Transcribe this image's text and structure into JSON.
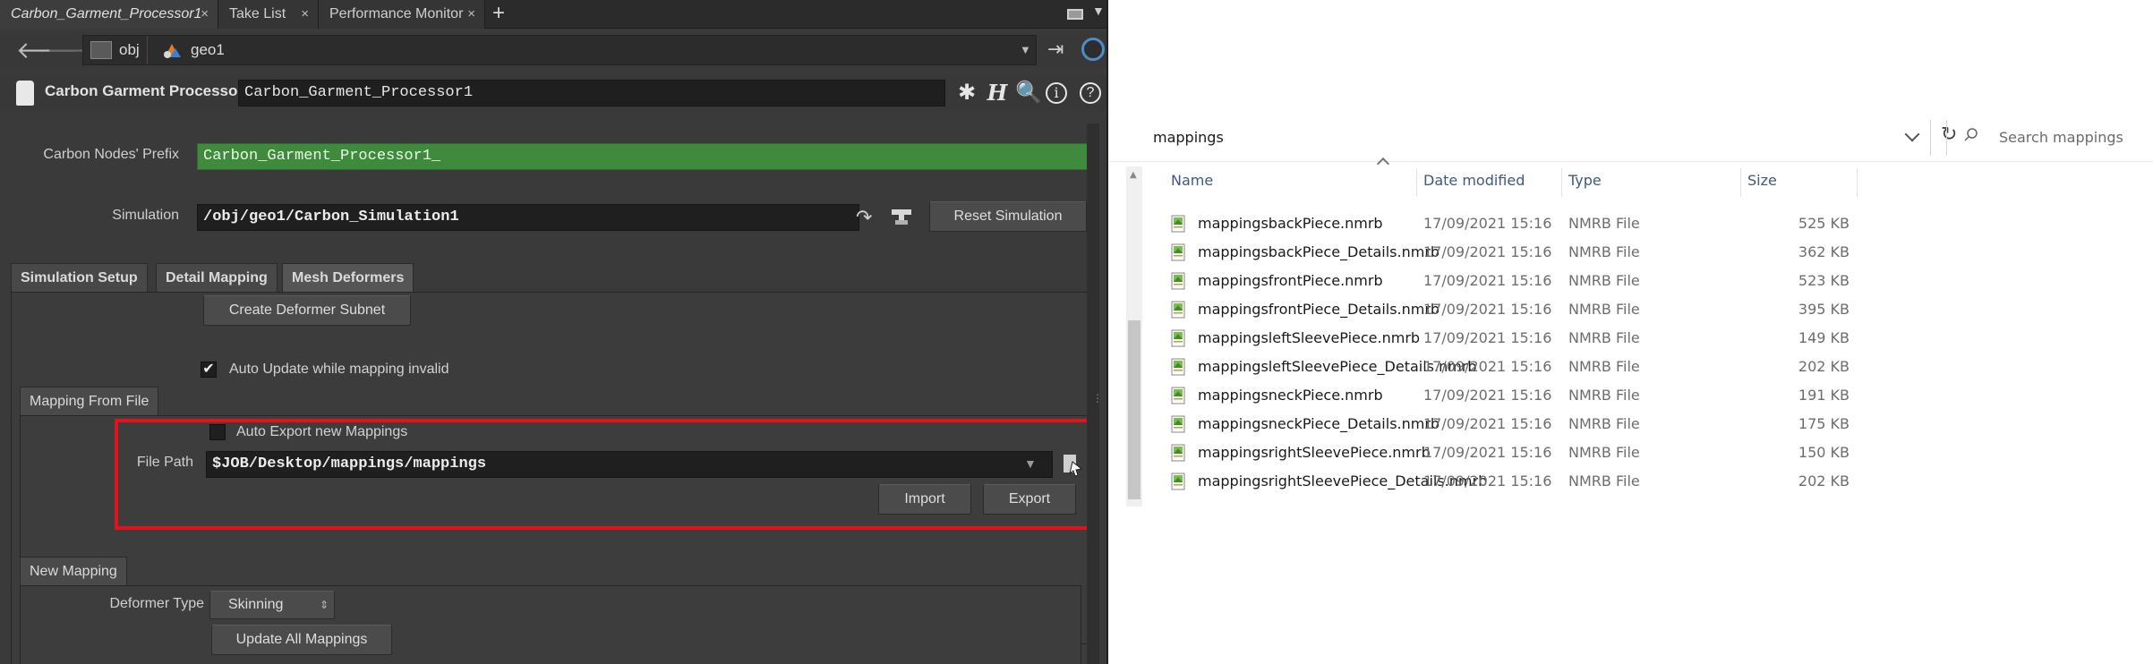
{
  "houdini": {
    "tabs": [
      {
        "label": "Carbon_Garment_Processor1",
        "close": "×"
      },
      {
        "label": "Take List",
        "close": "×"
      },
      {
        "label": "Performance Monitor",
        "close": "×"
      }
    ],
    "add_tab": "+",
    "path": {
      "crumb1": "obj",
      "crumb2": "geo1"
    },
    "node": {
      "type_label": "Carbon Garment Processor",
      "name": "Carbon_Garment_Processor1"
    },
    "prefix": {
      "label": "Carbon Nodes' Prefix",
      "value": "Carbon_Garment_Processor1_"
    },
    "simulation": {
      "label": "Simulation",
      "value": "/obj/geo1/Carbon_Simulation1",
      "reset_label": "Reset Simulation"
    },
    "main_tabs": [
      "Simulation Setup",
      "Detail Mapping",
      "Mesh Deformers"
    ],
    "create_subnet_label": "Create Deformer Subnet",
    "auto_update": {
      "label": "Auto Update while mapping invalid",
      "checked": true
    },
    "mapping_from_file": {
      "tab_label": "Mapping From File",
      "auto_export": {
        "label": "Auto Export new Mappings",
        "checked": false
      },
      "file_path_label": "File Path",
      "file_path_value": "$JOB/Desktop/mappings/mappings",
      "import_label": "Import",
      "export_label": "Export",
      "highlight_color": "#e0121c"
    },
    "new_mapping": {
      "tab_label": "New Mapping",
      "deformer_type_label": "Deformer Type",
      "deformer_type_value": "Skinning",
      "update_all_label": "Update All Mappings"
    },
    "colors": {
      "prefix_field": "#3f8a3c"
    }
  },
  "explorer": {
    "address": "mappings",
    "search_placeholder": "Search mappings",
    "columns": {
      "name": "Name",
      "date": "Date modified",
      "type": "Type",
      "size": "Size"
    },
    "files": [
      {
        "name": "mappingsbackPiece.nmrb",
        "date": "17/09/2021 15:16",
        "type": "NMRB File",
        "size": "525 KB"
      },
      {
        "name": "mappingsbackPiece_Details.nmrb",
        "date": "17/09/2021 15:16",
        "type": "NMRB File",
        "size": "362 KB"
      },
      {
        "name": "mappingsfrontPiece.nmrb",
        "date": "17/09/2021 15:16",
        "type": "NMRB File",
        "size": "523 KB"
      },
      {
        "name": "mappingsfrontPiece_Details.nmrb",
        "date": "17/09/2021 15:16",
        "type": "NMRB File",
        "size": "395 KB"
      },
      {
        "name": "mappingsleftSleevePiece.nmrb",
        "date": "17/09/2021 15:16",
        "type": "NMRB File",
        "size": "149 KB"
      },
      {
        "name": "mappingsleftSleevePiece_Details.nmrb",
        "date": "17/09/2021 15:16",
        "type": "NMRB File",
        "size": "202 KB"
      },
      {
        "name": "mappingsneckPiece.nmrb",
        "date": "17/09/2021 15:16",
        "type": "NMRB File",
        "size": "191 KB"
      },
      {
        "name": "mappingsneckPiece_Details.nmrb",
        "date": "17/09/2021 15:16",
        "type": "NMRB File",
        "size": "175 KB"
      },
      {
        "name": "mappingsrightSleevePiece.nmrb",
        "date": "17/09/2021 15:16",
        "type": "NMRB File",
        "size": "150 KB"
      },
      {
        "name": "mappingsrightSleevePiece_Details.nmrb",
        "date": "17/09/2021 15:16",
        "type": "NMRB File",
        "size": "202 KB"
      }
    ]
  }
}
